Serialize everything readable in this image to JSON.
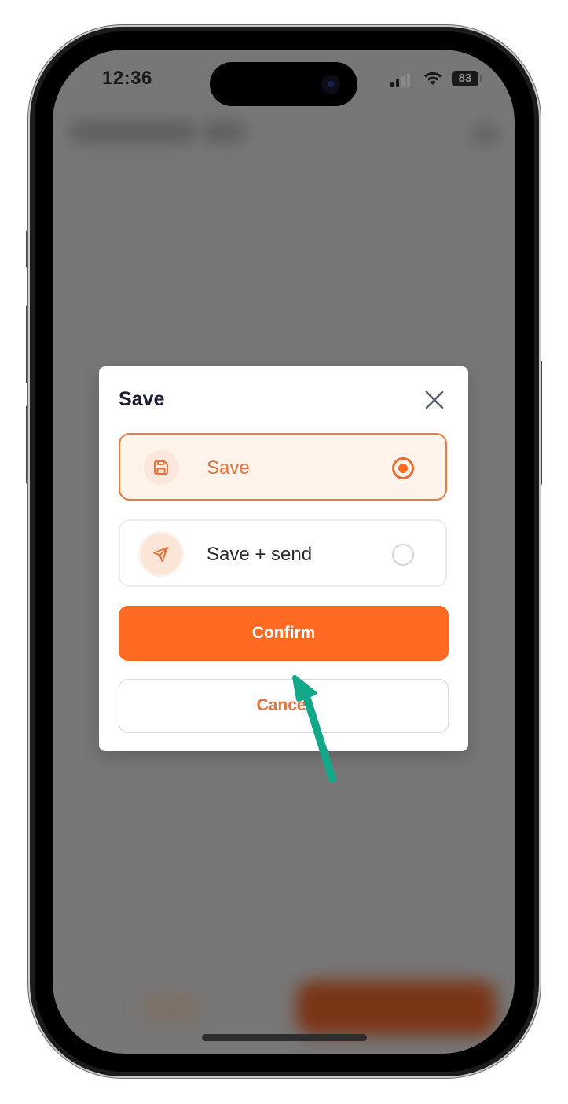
{
  "status_bar": {
    "time": "12:36",
    "battery_level": "83",
    "signal_bars_active": 2,
    "signal_bars_total": 4,
    "icons": [
      "cellular-signal-icon",
      "wifi-icon",
      "battery-icon"
    ]
  },
  "dialog": {
    "title": "Save",
    "close_icon": "close-icon",
    "options": [
      {
        "label": "Save",
        "icon": "floppy-disk-icon",
        "selected": true
      },
      {
        "label": "Save + send",
        "icon": "send-icon",
        "selected": false
      }
    ],
    "confirm_label": "Confirm",
    "cancel_label": "Cancel"
  },
  "colors": {
    "accent": "#ff6a23",
    "accent_text": "#e2733f",
    "selected_bg": "#fff3ea",
    "annotation_arrow": "#13a88a",
    "overlay": "#777777"
  },
  "annotation": {
    "type": "arrow",
    "points_to": "confirm-button"
  }
}
